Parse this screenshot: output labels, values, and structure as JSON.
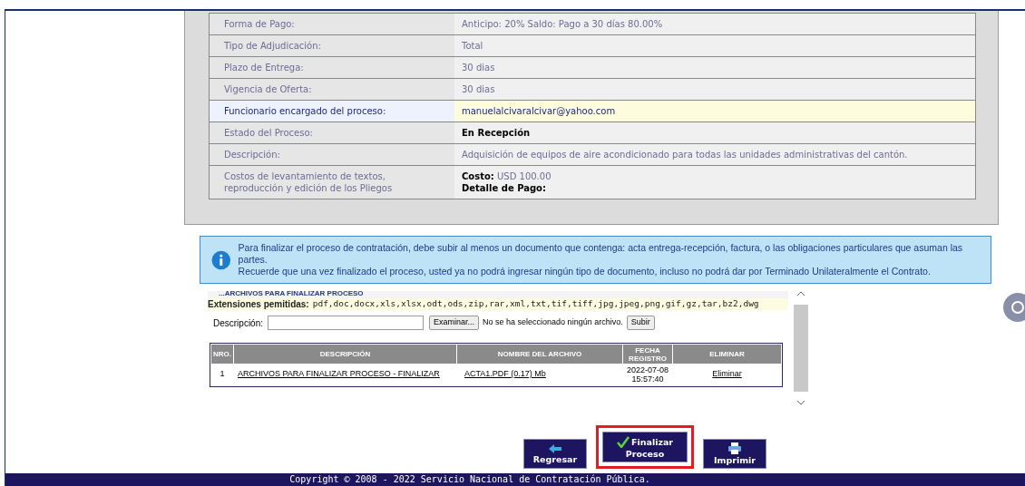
{
  "details": [
    {
      "label": "Forma de Pago:",
      "value": [
        "Anticipo: 20% Saldo: Pago a 30 días 80.00%"
      ],
      "highlighted": false,
      "bold": false
    },
    {
      "label": "Tipo de Adjudicación:",
      "value": [
        "Total"
      ],
      "highlighted": false,
      "bold": false
    },
    {
      "label": "Plazo de Entrega:",
      "value": [
        "30 dias"
      ],
      "highlighted": false,
      "bold": false
    },
    {
      "label": "Vigencia de Oferta:",
      "value": [
        "30 dias"
      ],
      "highlighted": false,
      "bold": false
    },
    {
      "label": "Funcionario encargado del proceso:",
      "value": [
        "manuelalcivaralcivar@yahoo.com"
      ],
      "highlighted": true,
      "bold": false
    },
    {
      "label": "Estado del Proceso:",
      "value": [
        "En Recepción"
      ],
      "highlighted": false,
      "bold": true
    },
    {
      "label": "Descripción:",
      "value": [
        "Adquisición de equipos de aire acondicionado para todas las unidades administrativas del cantón."
      ],
      "highlighted": false,
      "bold": false
    },
    {
      "label": "Costos de levantamiento de textos, reproducción y edición de los Pliegos",
      "value": [
        "**Costo:** USD 100.00",
        "**Detalle de Pago:**"
      ],
      "highlighted": false,
      "bold": false
    }
  ],
  "notice": {
    "lines": [
      "Para finalizar el proceso de contratación, debe subir al menos un documento que contenga: acta entrega-recepción, factura, o las obligaciones particulares que asuman las partes.",
      "Recuerde que una vez finalizado el proceso, usted ya no podrá ingresar ningún tipo de documento, incluso no podrá dar por Terminado Unilateralmente el Contrato."
    ]
  },
  "files": {
    "heading": "...ARCHIVOS PARA FINALIZAR PROCESO",
    "extensions_label": "Extensiones pemitidas:",
    "extensions": "pdf,doc,docx,xls,xlsx,odt,ods,zip,rar,xml,txt,tif,tiff,jpg,jpeg,png,gif,gz,tar,bz2,dwg",
    "description_label": "Descripción:",
    "browse_button": "Examinar...",
    "no_file": "No se ha seleccionado ningún archivo.",
    "upload_button": "Subir",
    "table": {
      "columns": [
        "NRO.",
        "DESCRIPCIÓN",
        "NOMBRE DEL ARCHIVO",
        "FECHA REGISTRO",
        "ELIMINAR"
      ],
      "rows": [
        {
          "nro": "1",
          "description": "ARCHIVOS PARA FINALIZAR PROCESO - FINALIZAR",
          "file": "ACTA1.PDF (0.17) Mb",
          "date": [
            "2022-07-08",
            "15:57:40"
          ],
          "delete": "Eliminar"
        }
      ]
    }
  },
  "buttons": [
    {
      "kind": "back",
      "label": "Regresar",
      "highlighted": false
    },
    {
      "kind": "finish",
      "label": "Finalizar Proceso",
      "highlighted": true
    },
    {
      "kind": "print",
      "label": "Imprimir",
      "highlighted": false
    }
  ],
  "footer": "Copyright © 2008 - 2022 Servicio Nacional de Contratación Pública."
}
